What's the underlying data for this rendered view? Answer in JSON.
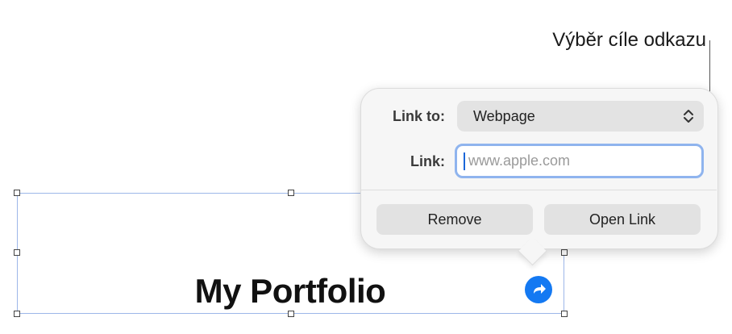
{
  "callout": {
    "label": "Výběr cíle odkazu"
  },
  "textbox": {
    "title": "My Portfolio",
    "link_badge_icon": "link-arrow-icon"
  },
  "popover": {
    "link_to_label": "Link to:",
    "link_to_value": "Webpage",
    "link_label": "Link:",
    "link_value": "",
    "link_placeholder": "www.apple.com",
    "remove_label": "Remove",
    "open_link_label": "Open Link"
  },
  "colors": {
    "accent": "#1479f2",
    "focus_ring": "#8fb4ee",
    "selection": "#9db7e8"
  }
}
